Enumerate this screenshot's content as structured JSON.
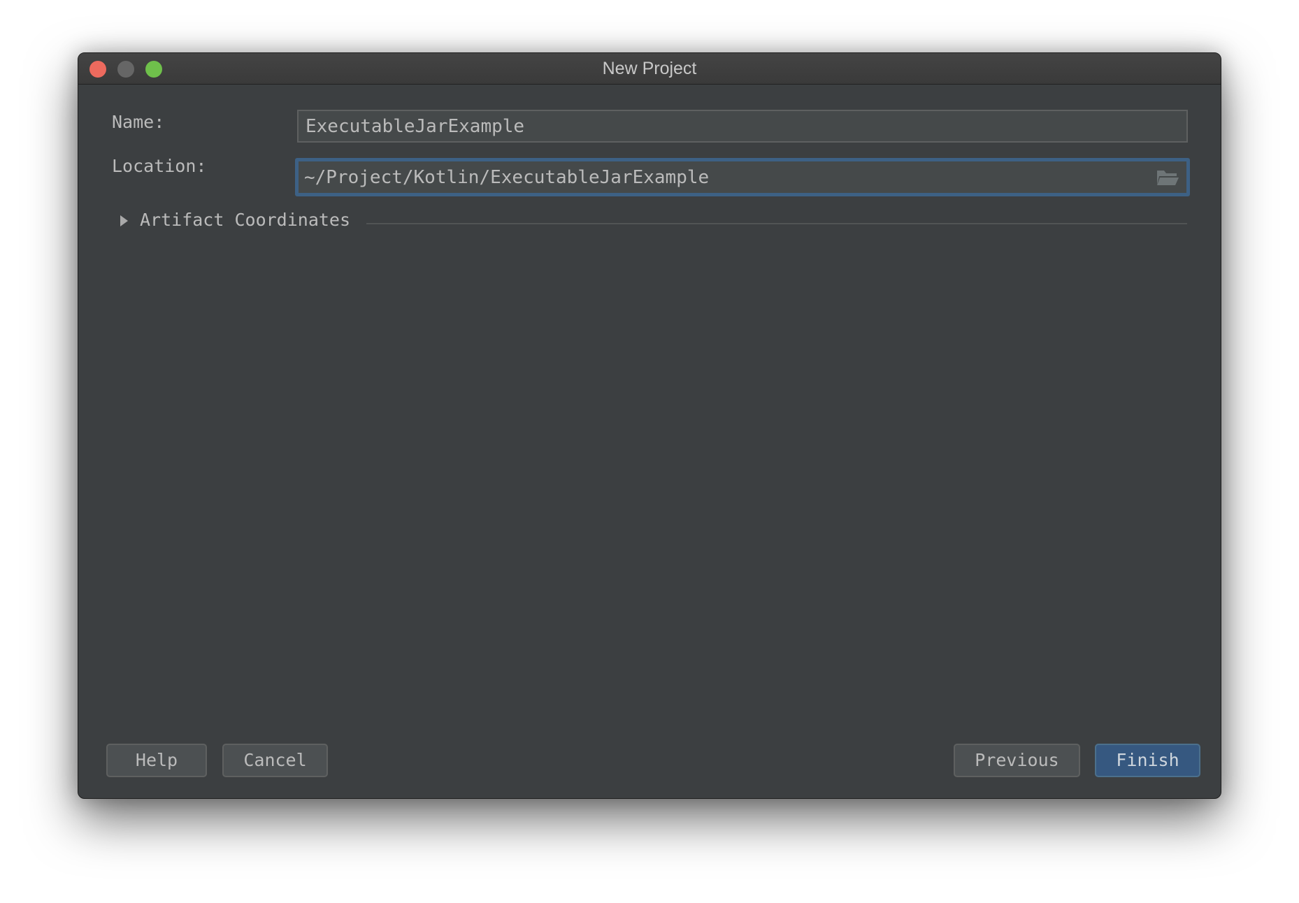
{
  "window": {
    "title": "New Project",
    "controls": [
      "close",
      "minimize",
      "maximize"
    ]
  },
  "form": {
    "name_label": "Name:",
    "name_value": "ExecutableJarExample",
    "location_label": "Location:",
    "location_value": "~/Project/Kotlin/ExecutableJarExample",
    "location_browse_icon": "folder-open-icon",
    "artifact_section_label": "Artifact Coordinates",
    "artifact_section_expanded": false
  },
  "footer": {
    "help_label": "Help",
    "cancel_label": "Cancel",
    "previous_label": "Previous",
    "finish_label": "Finish"
  },
  "colors": {
    "accent": "#365880",
    "focus_ring": "#3d6185",
    "background": "#3c3f41"
  }
}
